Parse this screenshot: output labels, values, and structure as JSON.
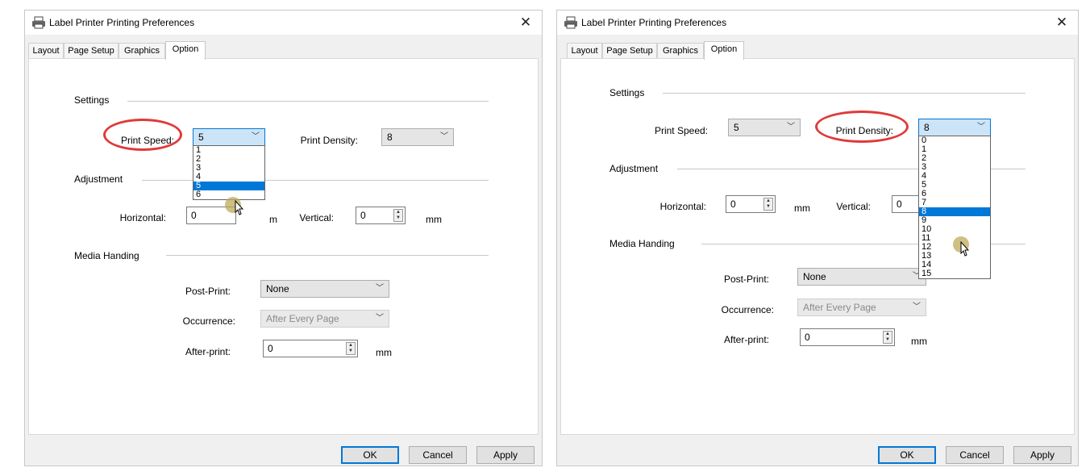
{
  "window": {
    "title": "Label Printer Printing Preferences",
    "close_glyph": "✕"
  },
  "tabs": [
    {
      "label": "Layout"
    },
    {
      "label": "Page Setup"
    },
    {
      "label": "Graphics"
    },
    {
      "label": "Option"
    }
  ],
  "sections": {
    "settings": "Settings",
    "adjustment": "Adjustment",
    "media": "Media Handing"
  },
  "fields": {
    "print_speed": {
      "label": "Print Speed:",
      "value": "5"
    },
    "print_density": {
      "label": "Print Density:",
      "value": "8"
    },
    "horizontal": {
      "label": "Horizontal:",
      "value": "0"
    },
    "vertical": {
      "label": "Vertical:",
      "value": "0"
    },
    "unit_mm": "mm",
    "post_print": {
      "label": "Post-Print:",
      "value": "None"
    },
    "occurrence": {
      "label": "Occurrence:",
      "value": "After Every Page"
    },
    "after_print": {
      "label": "After-print:",
      "value": "0"
    }
  },
  "speed_options": [
    "1",
    "2",
    "3",
    "4",
    "5",
    "6"
  ],
  "speed_selected": "5",
  "density_options": [
    "0",
    "1",
    "2",
    "3",
    "4",
    "5",
    "6",
    "7",
    "8",
    "9",
    "10",
    "11",
    "12",
    "13",
    "14",
    "15"
  ],
  "density_selected": "8",
  "buttons": {
    "ok": "OK",
    "cancel": "Cancel",
    "apply": "Apply"
  },
  "colors": {
    "highlight_ring": "#e03a3a",
    "selection": "#0078d7"
  },
  "icons": {
    "printer": "printer-icon",
    "close": "close-icon",
    "chevron": "chevron-down-icon",
    "spin": "spin-arrows-icon",
    "cursor": "mouse-pointer-icon"
  },
  "partial_labels": {
    "dialog1_horizontal_unit_fragment": "m",
    "dialog1_vertical_unit_fragment": "mm",
    "dialog2_after_unit_fragment": "mm"
  }
}
